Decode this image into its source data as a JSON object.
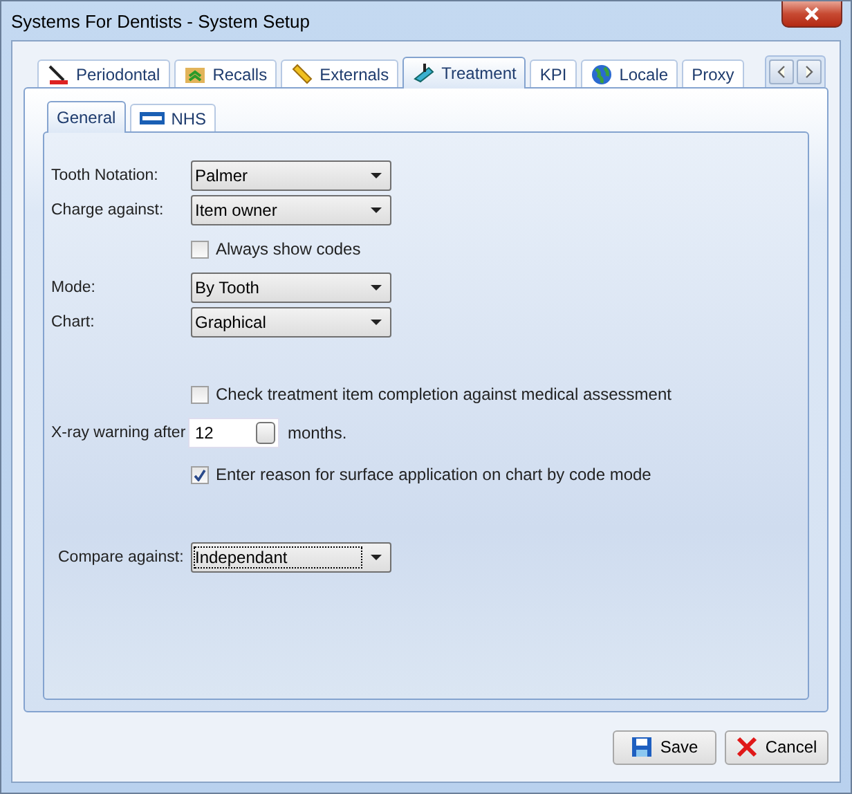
{
  "window": {
    "title": "Systems For Dentists - System Setup"
  },
  "tabs": [
    {
      "label": "Periodontal",
      "kind": "periodontal",
      "selected": false
    },
    {
      "label": "Recalls",
      "kind": "recalls",
      "selected": false
    },
    {
      "label": "Externals",
      "kind": "externals",
      "selected": false
    },
    {
      "label": "Treatment",
      "kind": "treatment",
      "selected": true
    },
    {
      "label": "KPI",
      "kind": "plain",
      "selected": false
    },
    {
      "label": "Locale",
      "kind": "locale",
      "selected": false
    },
    {
      "label": "Proxy",
      "kind": "plain",
      "selected": false
    }
  ],
  "subtabs": [
    {
      "label": "General",
      "kind": "plain",
      "selected": true
    },
    {
      "label": "NHS",
      "kind": "nhs",
      "selected": false
    }
  ],
  "form": [
    {
      "kind": "select",
      "label": "Tooth Notation:",
      "value": "Palmer",
      "focused": false
    },
    {
      "kind": "select",
      "label": "Charge against:",
      "value": "Item owner",
      "focused": false
    },
    {
      "kind": "checkbox",
      "label": "Always show codes",
      "checked": false
    },
    {
      "kind": "select",
      "label": "Mode:",
      "value": "By Tooth",
      "focused": false
    },
    {
      "kind": "select",
      "label": "Chart:",
      "value": "Graphical",
      "focused": false
    },
    {
      "kind": "checkbox",
      "label": "Check treatment item completion against medical assessment",
      "checked": false
    },
    {
      "kind": "spin",
      "label": "X-ray warning after",
      "value": "12",
      "suffix": "months."
    },
    {
      "kind": "checkbox",
      "label": "Enter reason for surface application on chart by code mode",
      "checked": true
    },
    {
      "kind": "select",
      "label": "Compare against:",
      "value": "Independant",
      "focused": true
    }
  ],
  "buttons": [
    {
      "label": "Save",
      "kind": "save"
    },
    {
      "label": "Cancel",
      "kind": "cancel"
    }
  ]
}
